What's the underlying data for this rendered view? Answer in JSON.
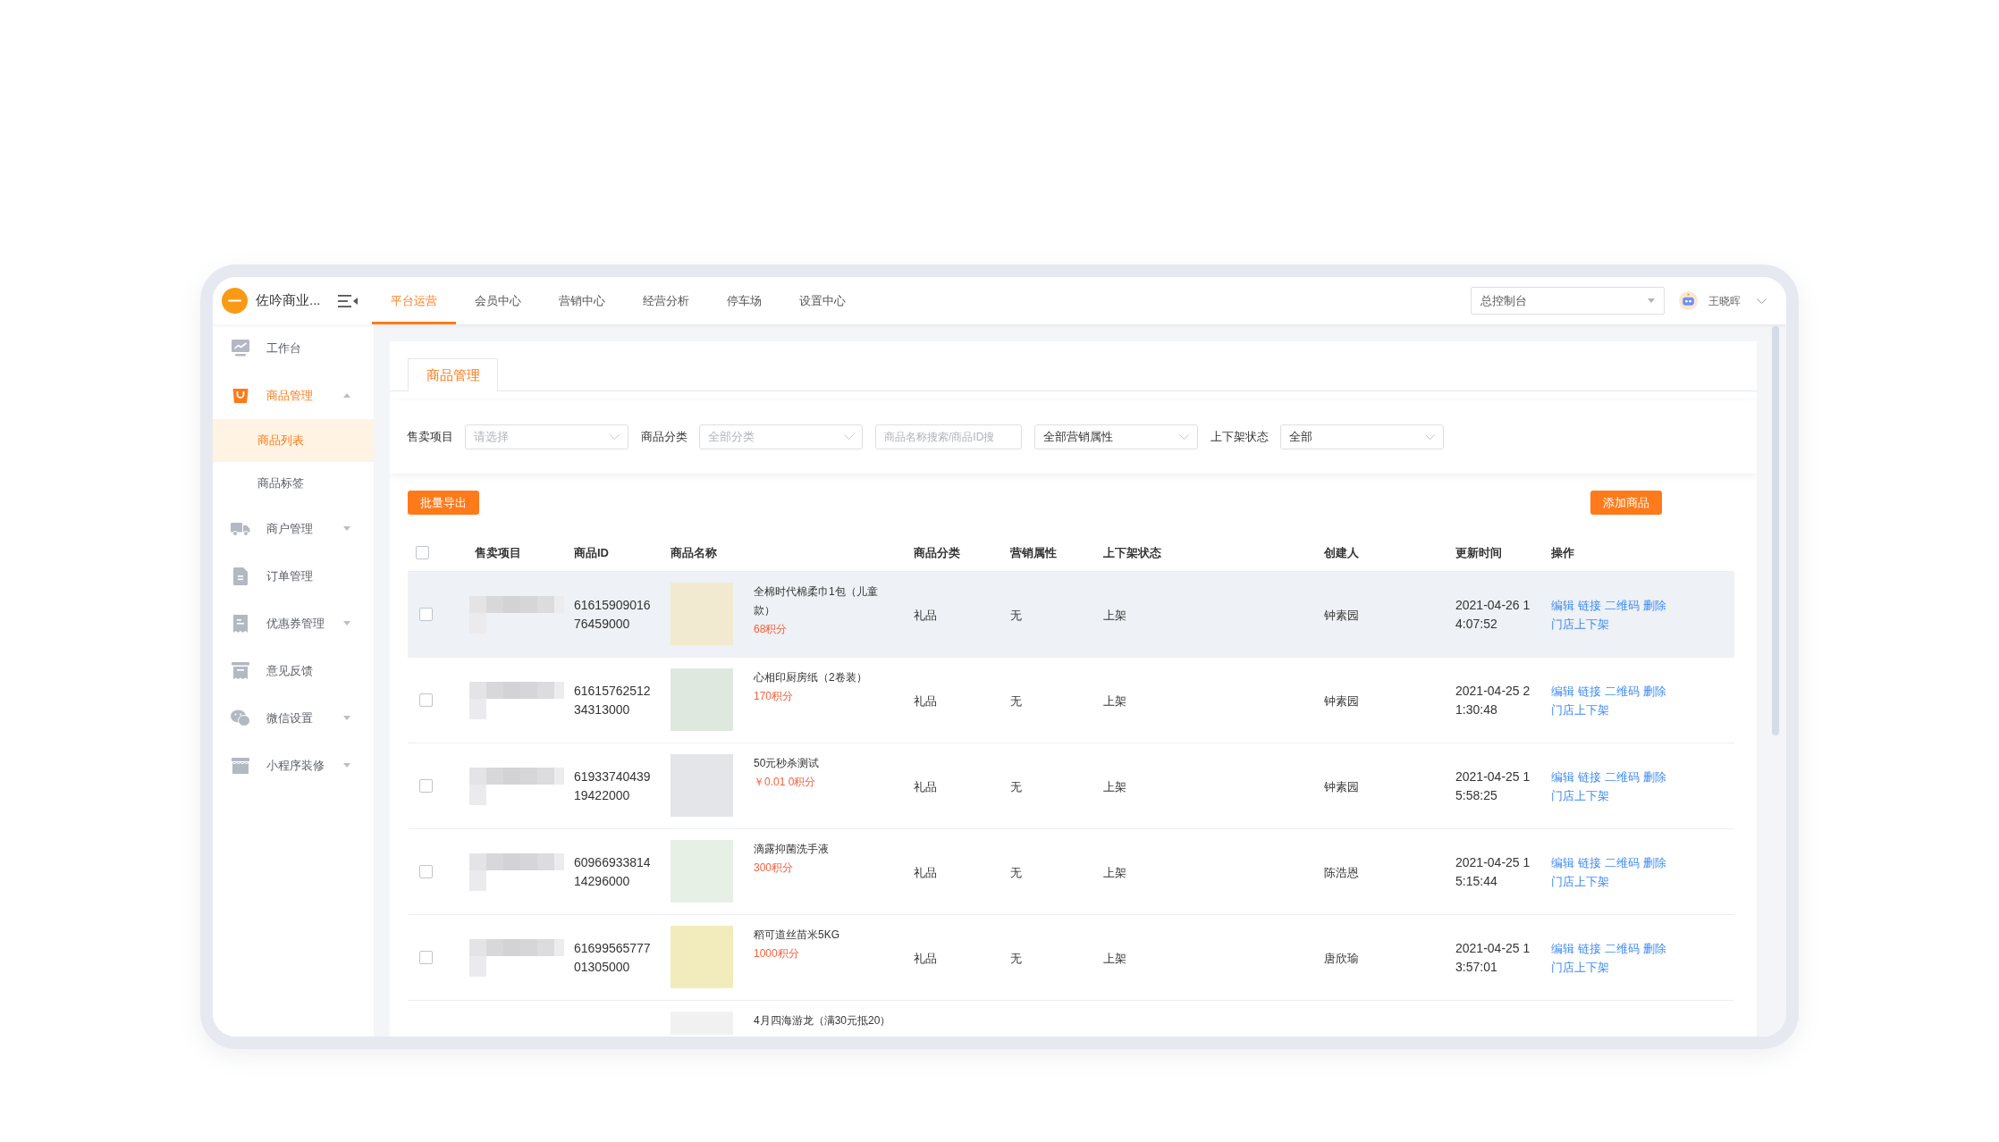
{
  "header": {
    "brand": "佐吟商业...",
    "nav": [
      {
        "label": "平台运营",
        "selected": true
      },
      {
        "label": "会员中心",
        "selected": false
      },
      {
        "label": "营销中心",
        "selected": false
      },
      {
        "label": "经营分析",
        "selected": false
      },
      {
        "label": "停车场",
        "selected": false
      },
      {
        "label": "设置中心",
        "selected": false
      }
    ],
    "store_select": {
      "value": "总控制台"
    },
    "user": {
      "name": "王晓晖"
    }
  },
  "sidebar": {
    "items": [
      {
        "label": "工作台",
        "kind": "link",
        "selected": false
      },
      {
        "label": "商品管理",
        "kind": "group",
        "selected": true,
        "expanded": true,
        "children": [
          {
            "label": "商品列表",
            "selected": true
          },
          {
            "label": "商品标签",
            "selected": false
          }
        ]
      },
      {
        "label": "商户管理",
        "kind": "group",
        "selected": false,
        "expanded": false
      },
      {
        "label": "订单管理",
        "kind": "link",
        "selected": false
      },
      {
        "label": "优惠券管理",
        "kind": "group",
        "selected": false,
        "expanded": false
      },
      {
        "label": "意见反馈",
        "kind": "link",
        "selected": false
      },
      {
        "label": "微信设置",
        "kind": "group",
        "selected": false,
        "expanded": false
      },
      {
        "label": "小程序装修",
        "kind": "group",
        "selected": false,
        "expanded": false
      }
    ]
  },
  "tabs": [
    {
      "label": "商品管理",
      "selected": true
    }
  ],
  "filters": [
    {
      "kind": "select",
      "label": "售卖项目",
      "placeholder": "请选择"
    },
    {
      "kind": "select",
      "label": "商品分类",
      "placeholder": "全部分类"
    },
    {
      "kind": "input",
      "placeholder": "商品名称搜索/商品ID搜"
    },
    {
      "kind": "select",
      "value": "全部营销属性"
    },
    {
      "kind": "select",
      "label": "上下架状态",
      "value": "全部"
    }
  ],
  "toolbar": {
    "export_button": "批量导出",
    "add_button": "添加商品"
  },
  "table": {
    "columns": [
      "售卖项目",
      "商品ID",
      "商品名称",
      "商品分类",
      "营销属性",
      "上下架状态",
      "创建人",
      "更新时间",
      "操作"
    ],
    "all_checked": false,
    "rows": [
      {
        "checked": false,
        "hovered": true,
        "id": "6161590901676459000",
        "name": "全棉时代棉柔巾1包（儿童款）",
        "price": "68积分",
        "category": "礼品",
        "marketing": "无",
        "status": "上架",
        "creator": "钟素园",
        "updated": "2021-04-26 14:07:52",
        "actions": [
          "编辑",
          "链接",
          "二维码",
          "删除",
          "门店上下架"
        ]
      },
      {
        "checked": false,
        "hovered": false,
        "id": "6161576251234313000",
        "name": "心相印厨房纸（2卷装）",
        "price": "170积分",
        "category": "礼品",
        "marketing": "无",
        "status": "上架",
        "creator": "钟素园",
        "updated": "2021-04-25 21:30:48",
        "actions": [
          "编辑",
          "链接",
          "二维码",
          "删除",
          "门店上下架"
        ]
      },
      {
        "checked": false,
        "hovered": false,
        "id": "6193374043919422000",
        "name": "50元秒杀测试",
        "price": "￥0.01 0积分",
        "category": "礼品",
        "marketing": "无",
        "status": "上架",
        "creator": "钟素园",
        "updated": "2021-04-25 15:58:25",
        "actions": [
          "编辑",
          "链接",
          "二维码",
          "删除",
          "门店上下架"
        ]
      },
      {
        "checked": false,
        "hovered": false,
        "id": "6096693381414296000",
        "name": "滴露抑菌洗手液",
        "price": "300积分",
        "category": "礼品",
        "marketing": "无",
        "status": "上架",
        "creator": "陈浩恩",
        "updated": "2021-04-25 15:15:44",
        "actions": [
          "编辑",
          "链接",
          "二维码",
          "删除",
          "门店上下架"
        ]
      },
      {
        "checked": false,
        "hovered": false,
        "id": "6169956577701305000",
        "name": "稻可道丝苗米5KG",
        "price": "1000积分",
        "category": "礼品",
        "marketing": "无",
        "status": "上架",
        "creator": "唐欣瑜",
        "updated": "2021-04-25 13:57:01",
        "actions": [
          "编辑",
          "链接",
          "二维码",
          "删除",
          "门店上下架"
        ]
      }
    ],
    "partial_row": {
      "name": "4月四海游龙（满30元抵20）"
    }
  }
}
